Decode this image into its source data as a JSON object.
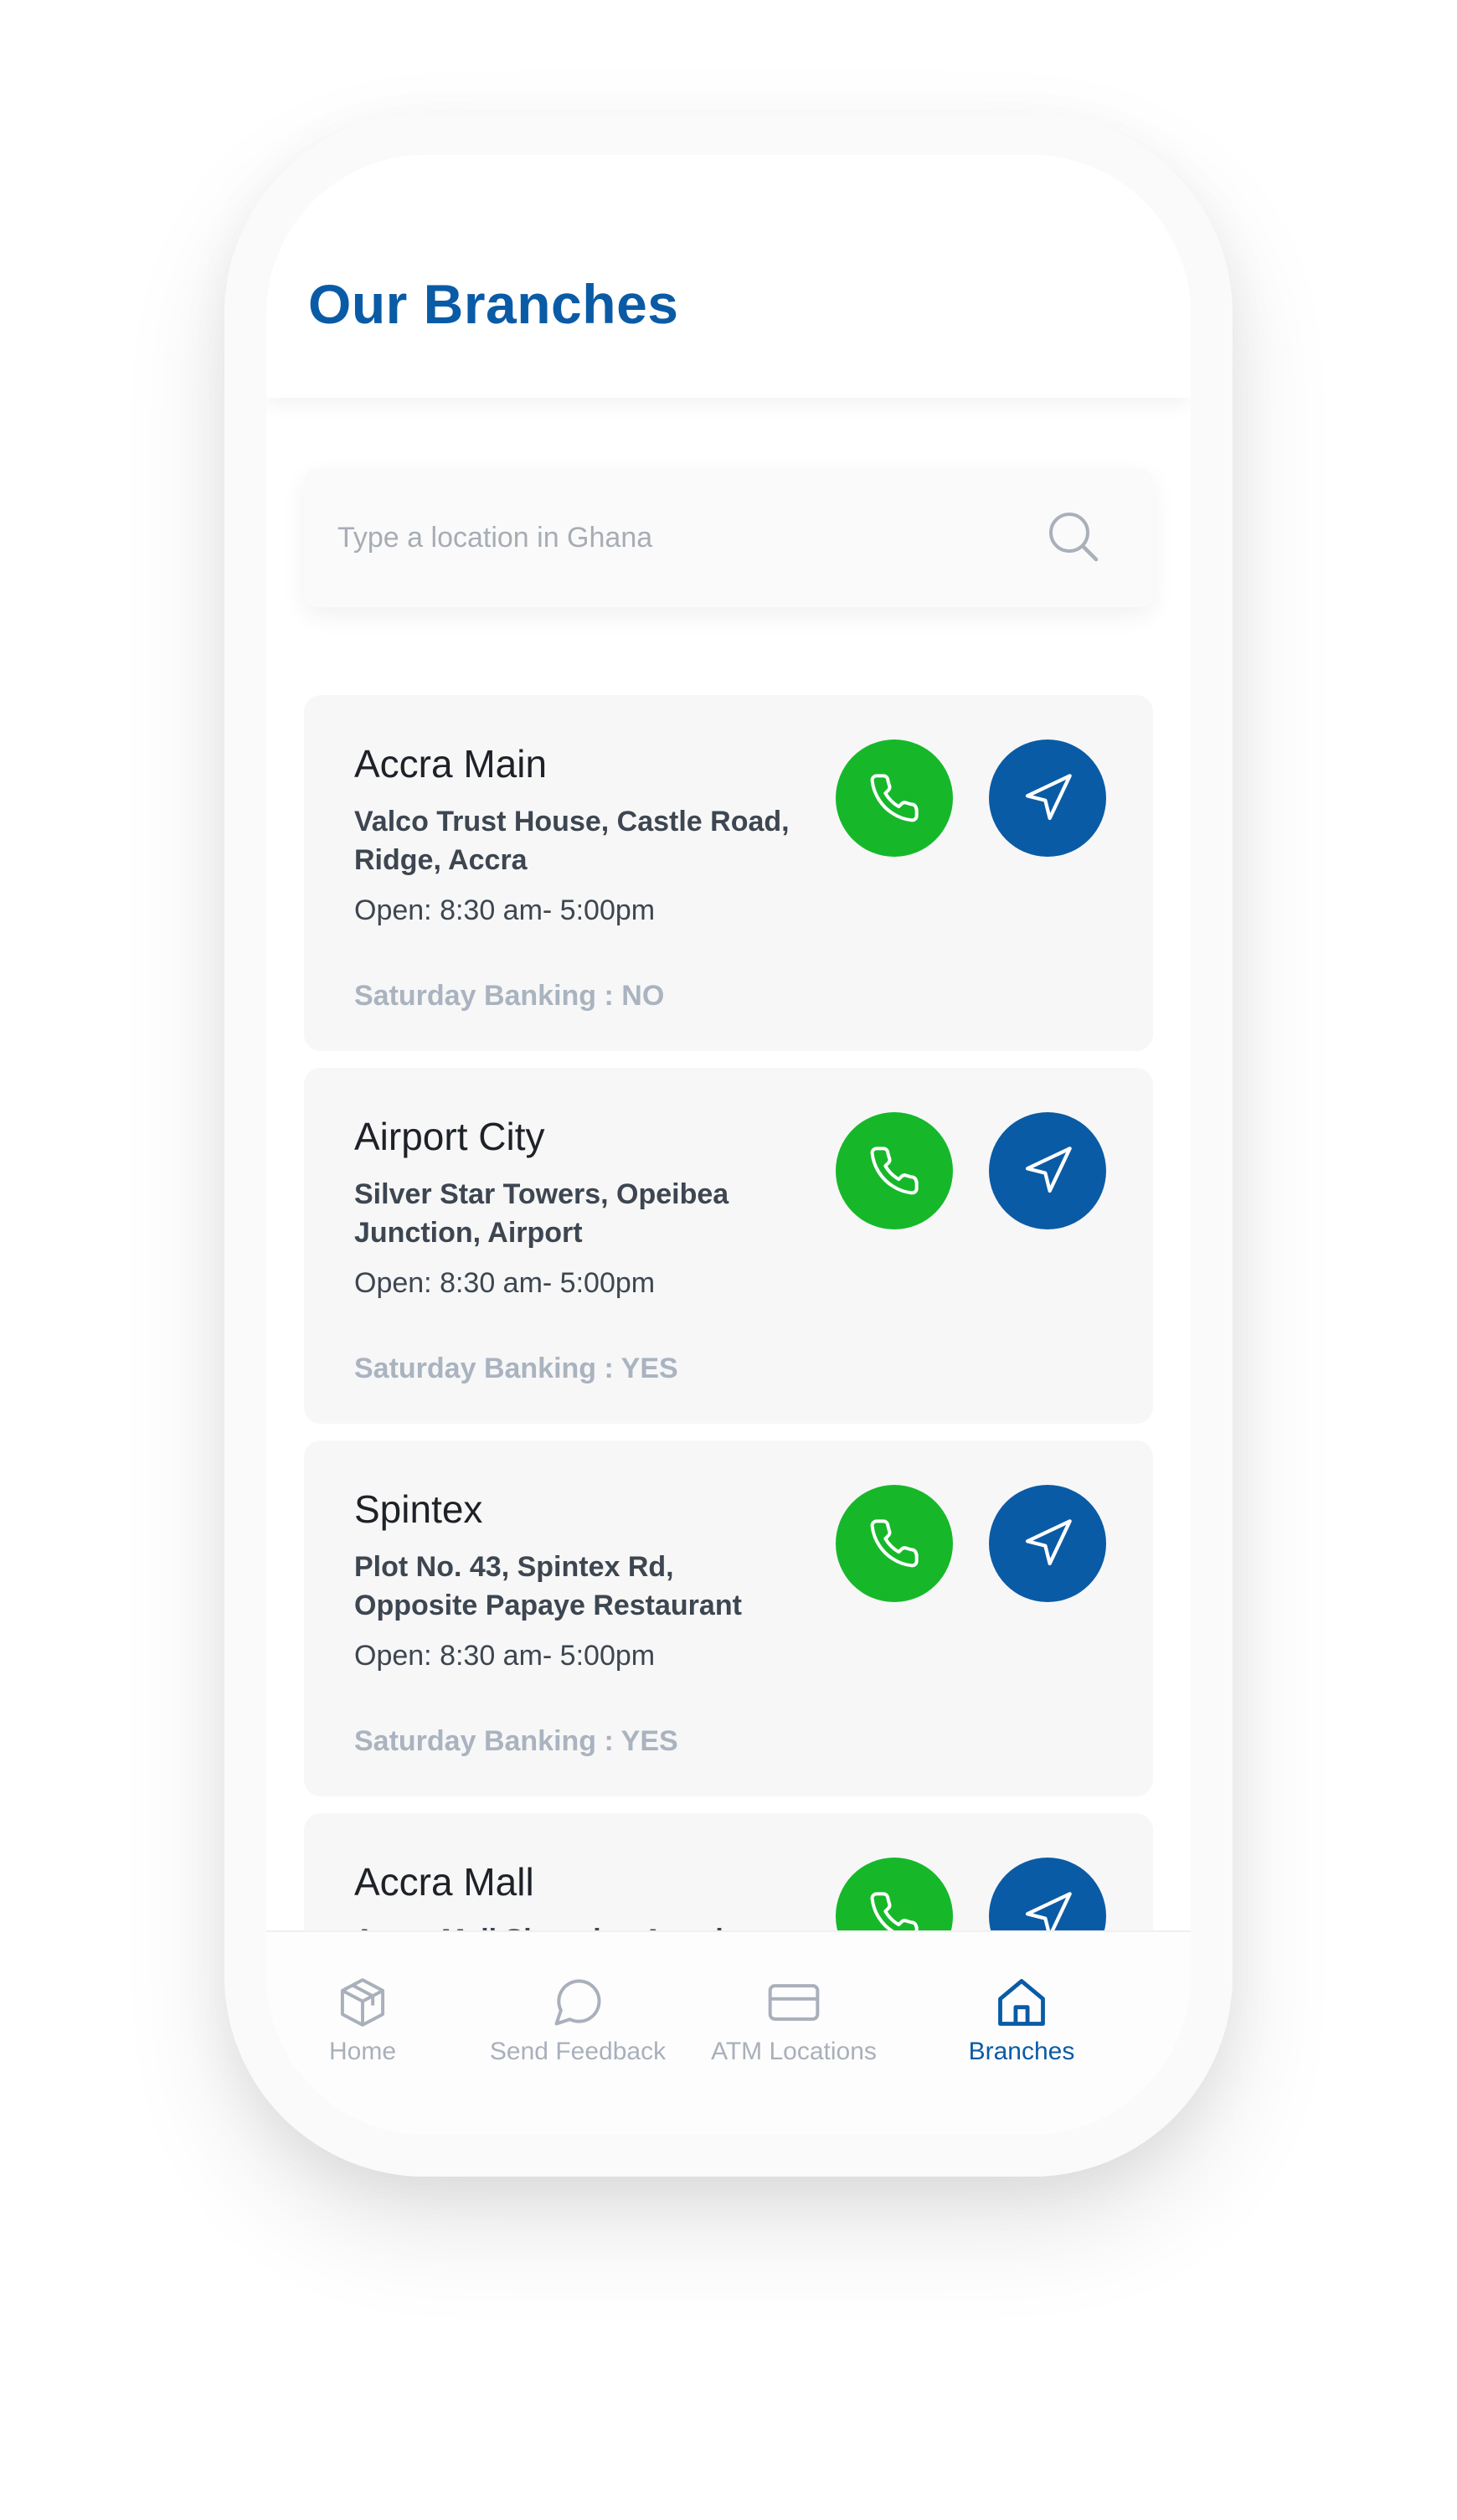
{
  "header": {
    "title": "Our Branches"
  },
  "search": {
    "placeholder": "Type a location in Ghana",
    "value": ""
  },
  "branches": [
    {
      "name": "Accra Main",
      "address": "Valco Trust House, Castle Road, Ridge, Accra",
      "hours": "Open: 8:30 am- 5:00pm",
      "saturday": "Saturday Banking : NO"
    },
    {
      "name": "Airport City",
      "address": "Silver Star Towers, Opeibea Junction, Airport",
      "hours": "Open: 8:30 am- 5:00pm",
      "saturday": "Saturday Banking : YES"
    },
    {
      "name": "Spintex",
      "address": "Plot No. 43, Spintex Rd, Opposite Papaye Restaurant",
      "hours": "Open: 8:30 am- 5:00pm",
      "saturday": "Saturday Banking : YES"
    },
    {
      "name": "Accra Mall",
      "address": "Accra Mall Shopping Arcade,",
      "hours": "",
      "saturday": ""
    }
  ],
  "nav": {
    "items": [
      {
        "label": "Home",
        "icon": "cube-icon",
        "active": false
      },
      {
        "label": "Send Feedback",
        "icon": "chat-bubble-icon",
        "active": false
      },
      {
        "label": "ATM Locations",
        "icon": "card-icon",
        "active": false
      },
      {
        "label": "Branches",
        "icon": "house-icon",
        "active": true
      }
    ]
  },
  "colors": {
    "brand_blue": "#0a5ba6",
    "call_green": "#16b82a",
    "inactive_gray": "#a9b0bb"
  }
}
